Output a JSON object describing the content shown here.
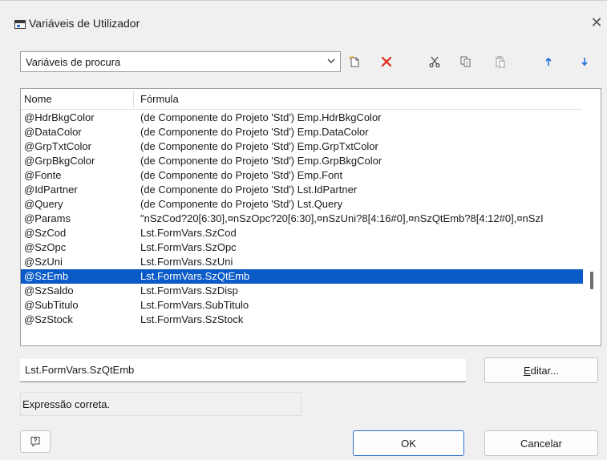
{
  "window": {
    "title": "Variáveis de Utilizador",
    "close_symbol": "✕"
  },
  "toolbar": {
    "combo_value": "Variáveis de procura",
    "icons": [
      "new-item-icon",
      "delete-icon",
      "cut-icon",
      "copy-icon",
      "paste-icon",
      "move-up-icon",
      "move-down-icon"
    ],
    "delete_color": "#e0281b",
    "arrow_color": "#1f6fd6"
  },
  "list": {
    "headers": {
      "name": "Nome",
      "formula": "Fórmula"
    },
    "rows": [
      {
        "name": "@HdrBkgColor",
        "formula": "(de Componente do Projeto 'Std') Emp.HdrBkgColor"
      },
      {
        "name": "@DataColor",
        "formula": "(de Componente do Projeto 'Std') Emp.DataColor"
      },
      {
        "name": "@GrpTxtColor",
        "formula": "(de Componente do Projeto 'Std') Emp.GrpTxtColor"
      },
      {
        "name": "@GrpBkgColor",
        "formula": "(de Componente do Projeto 'Std') Emp.GrpBkgColor"
      },
      {
        "name": "@Fonte",
        "formula": "(de Componente do Projeto 'Std') Emp.Font"
      },
      {
        "name": "@IdPartner",
        "formula": "(de Componente do Projeto 'Std') Lst.IdPartner"
      },
      {
        "name": "@Query",
        "formula": "(de Componente do Projeto 'Std') Lst.Query"
      },
      {
        "name": "@Params",
        "formula": "\"nSzCod?20[6:30],¤nSzOpc?20[6:30],¤nSzUni?8[4:16#0],¤nSzQtEmb?8[4:12#0],¤nSzI"
      },
      {
        "name": "@SzCod",
        "formula": "Lst.FormVars.SzCod"
      },
      {
        "name": "@SzOpc",
        "formula": "Lst.FormVars.SzOpc"
      },
      {
        "name": "@SzUni",
        "formula": "Lst.FormVars.SzUni"
      },
      {
        "name": "@SzEmb",
        "formula": "Lst.FormVars.SzQtEmb",
        "selected": true
      },
      {
        "name": "@SzSaldo",
        "formula": "Lst.FormVars.SzDisp"
      },
      {
        "name": "@SubTitulo",
        "formula": "Lst.FormVars.SubTitulo"
      },
      {
        "name": "@SzStock",
        "formula": "Lst.FormVars.SzStock"
      }
    ],
    "selected_color": "#0a5ac8"
  },
  "editor": {
    "formula_value": "Lst.FormVars.SzQtEmb",
    "edit_label_underlined": "E",
    "edit_label_rest": "ditar..."
  },
  "status": {
    "text": "Expressão correta."
  },
  "footer": {
    "help_icon": "help-icon",
    "ok_label": "OK",
    "cancel_label": "Cancelar"
  }
}
